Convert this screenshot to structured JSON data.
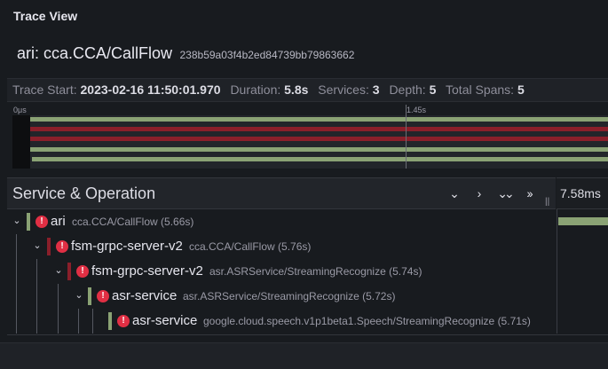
{
  "panel": {
    "title": "Trace View"
  },
  "trace": {
    "name": "ari: cca.CCA/CallFlow",
    "id": "238b59a03f4b2ed84739bb79863662"
  },
  "summary": {
    "start_label": "Trace Start:",
    "start_value": "2023-02-16 11:50:01.970",
    "duration_label": "Duration:",
    "duration_value": "5.8s",
    "services_label": "Services:",
    "services_value": "3",
    "depth_label": "Depth:",
    "depth_value": "5",
    "spans_label": "Total Spans:",
    "spans_value": "5"
  },
  "minimap": {
    "tick_start": "0μs",
    "tick_mid": "1.45s",
    "colors": {
      "ok": "#8aa274",
      "error": "#8a1f2a"
    }
  },
  "table": {
    "header_title": "Service & Operation",
    "buttons": {
      "collapse_one": "⌄",
      "expand_one": "›",
      "collapse_all": "⌄⌄",
      "expand_all": "››"
    },
    "timeline_label": "7.58ms",
    "error_glyph": "!",
    "chevron_glyph": "⌄"
  },
  "spans": [
    {
      "service": "ari",
      "operation": "cca.CCA/CallFlow (5.66s)",
      "color": "#8aa274",
      "error": true
    },
    {
      "service": "fsm-grpc-server-v2",
      "operation": "cca.CCA/CallFlow (5.76s)",
      "color": "#8a1f2a",
      "error": true
    },
    {
      "service": "fsm-grpc-server-v2",
      "operation": "asr.ASRService/StreamingRecognize (5.74s)",
      "color": "#8a1f2a",
      "error": true
    },
    {
      "service": "asr-service",
      "operation": "asr.ASRService/StreamingRecognize (5.72s)",
      "color": "#8aa274",
      "error": true
    },
    {
      "service": "asr-service",
      "operation": "google.cloud.speech.v1p1beta1.Speech/StreamingRecognize (5.71s)",
      "color": "#8aa274",
      "error": true
    }
  ]
}
